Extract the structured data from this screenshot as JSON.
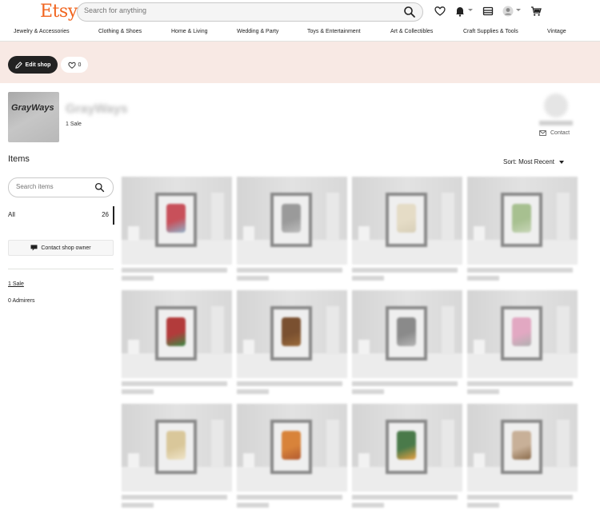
{
  "header": {
    "logo": "Etsy",
    "search_placeholder": "Search for anything",
    "nav": [
      "Jewelry & Accessories",
      "Clothing & Shoes",
      "Home & Living",
      "Wedding & Party",
      "Toys & Entertainment",
      "Art & Collectibles",
      "Craft Supplies & Tools",
      "Vintage"
    ]
  },
  "banner": {
    "edit_label": "Edit shop",
    "favorite_count": "0"
  },
  "shop": {
    "logo_text": "GrayWays",
    "name": "GrayWays",
    "sales": "1 Sale",
    "contact_label": "Contact"
  },
  "sidebar": {
    "heading": "Items",
    "search_placeholder": "Search items",
    "categories": [
      {
        "label": "All",
        "count": "26"
      }
    ],
    "contact_owner_label": "Contact shop owner",
    "sales_link": "1 Sale",
    "admirers": "0 Admirers"
  },
  "sort": {
    "label": "Sort: Most Recent"
  },
  "items": [
    {
      "art_color": "#c8505a",
      "art2": "#8fb0c8"
    },
    {
      "art_color": "#9a9a9a",
      "art2": "#bdbdbd"
    },
    {
      "art_color": "#e5dcc6",
      "art2": "#d8cfb8"
    },
    {
      "art_color": "#a7c090",
      "art2": "#c8d6b8"
    },
    {
      "art_color": "#b23b3b",
      "art2": "#3a8a44"
    },
    {
      "art_color": "#7a5030",
      "art2": "#9a6a3a"
    },
    {
      "art_color": "#8a8a8a",
      "art2": "#b5b5b5"
    },
    {
      "art_color": "#e2a8c2",
      "art2": "#b0b0b0"
    },
    {
      "art_color": "#d9c79a",
      "art2": "#efe4c8"
    },
    {
      "art_color": "#d8833a",
      "art2": "#b25a30"
    },
    {
      "art_color": "#4a7a4a",
      "art2": "#e8a040"
    },
    {
      "art_color": "#c8b098",
      "art2": "#8a6a4a"
    }
  ],
  "colors": {
    "brand": "#f1641e",
    "banner": "#f8e9e4",
    "dark_button": "#222222"
  }
}
